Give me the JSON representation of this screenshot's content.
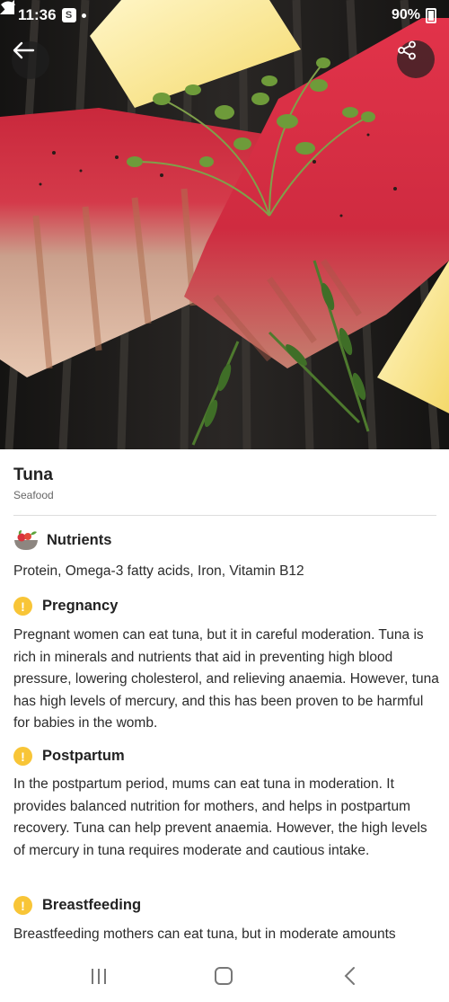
{
  "status_bar": {
    "time": "11:36",
    "left_badge": "S",
    "battery": "90%"
  },
  "hero": {
    "icons": [
      "back-arrow-icon",
      "share-icon"
    ]
  },
  "food": {
    "name": "Tuna",
    "category": "Seafood"
  },
  "sections": {
    "nutrients": {
      "title": "Nutrients",
      "icon": "food-bowl-icon",
      "body": "Protein, Omega-3 fatty acids, Iron, Vitamin B12"
    },
    "pregnancy": {
      "title": "Pregnancy",
      "icon": "exclamation-icon",
      "body": "Pregnant women can eat tuna, but it in careful moderation. Tuna is rich in minerals and nutrients that aid in preventing high blood pressure, lowering cholesterol, and relieving anaemia. However, tuna has high levels of mercury, and this has been proven to be harmful for babies in the womb."
    },
    "postpartum": {
      "title": "Postpartum",
      "icon": "exclamation-icon",
      "body": "In the postpartum period, mums can eat tuna in moderation. It provides balanced nutrition for mothers, and helps in postpartum recovery. Tuna can help prevent anaemia. However, the high levels of mercury in tuna requires moderate and cautious intake."
    },
    "breastfeeding": {
      "title": "Breastfeeding",
      "icon": "exclamation-icon",
      "body": "Breastfeeding mothers can eat tuna, but in moderate amounts"
    }
  },
  "colors": {
    "warning": "#f8c537",
    "text": "#2b2b2b"
  }
}
